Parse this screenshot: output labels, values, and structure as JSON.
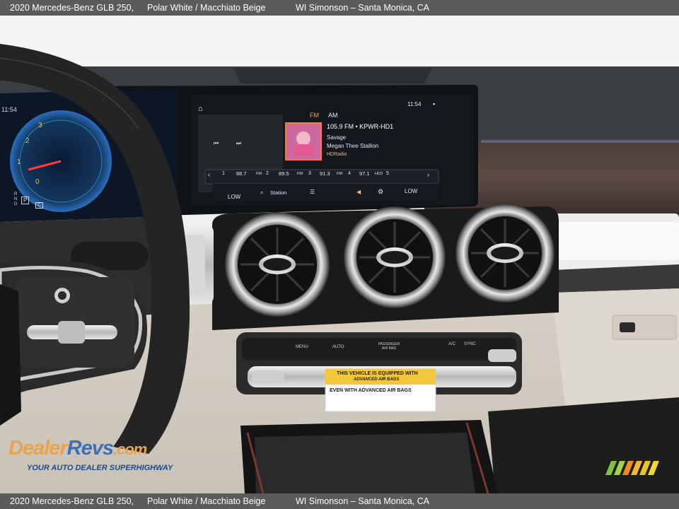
{
  "caption": {
    "vehicle": "2020 Mercedes-Benz GLB 250,",
    "colors": "Polar White / Macchiato Beige",
    "dealer": "WI Simonson – Santa Monica, CA"
  },
  "cluster": {
    "clock": "11:54",
    "gauge_labels": [
      "3",
      "2",
      "1",
      "0"
    ],
    "gear_letters": "R N D",
    "gear_p": "P",
    "gear_c": "C"
  },
  "infotainment": {
    "clock": "11:54",
    "bands": [
      "FM",
      "AM"
    ],
    "station_line": "105.9 FM • KPWR-HD1",
    "track_title": "Savage",
    "track_artist": "Megan Thee Stallion",
    "service": "HDRadio",
    "presets": [
      {
        "freq": "88.7",
        "band": "FM",
        "num": "2"
      },
      {
        "freq": "89.5",
        "band": "FM",
        "num": "3"
      },
      {
        "freq": "91.3",
        "band": "FM",
        "num": "4"
      },
      {
        "freq": "97.1",
        "band": "HD3",
        "num": "5"
      }
    ],
    "preset_first": "1",
    "fan_left": "LOW",
    "fan_right": "LOW",
    "station_button": "Station",
    "colors": {
      "screen_bg": "#0f1216",
      "accent": "#ff7a2b",
      "text": "#dfe8ef"
    }
  },
  "climate_panel": {
    "labels": [
      "MENU",
      "AUTO",
      "PASSENGER AIR BAG",
      "A/C",
      "SYNC"
    ]
  },
  "airbag_label": {
    "line1": "THIS VEHICLE IS EQUIPPED WITH",
    "line2": "ADVANCED AIR BAGS",
    "line3": "EVEN WITH ADVANCED AIR BAGS"
  },
  "watermark": {
    "brand_a": "Dealer",
    "brand_b": "Revs",
    "brand_c": ".com",
    "tagline": "YOUR AUTO DEALER SUPERHIGHWAY"
  }
}
